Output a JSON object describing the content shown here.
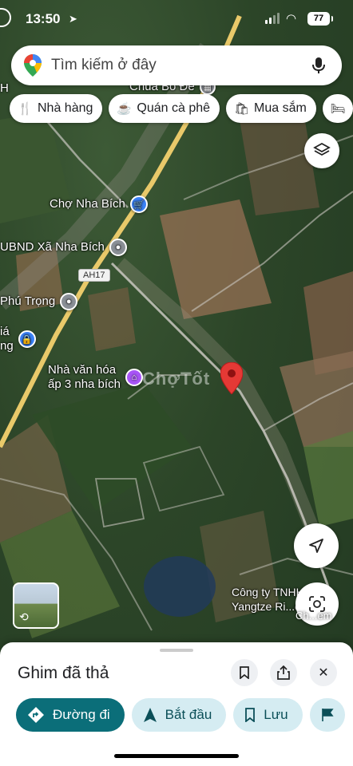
{
  "status_bar": {
    "time": "13:50",
    "battery": "77"
  },
  "search": {
    "placeholder": "Tìm kiếm ở đây"
  },
  "chips": [
    {
      "label": "Nhà hàng",
      "icon": "fork-knife-icon"
    },
    {
      "label": "Quán cà phê",
      "icon": "coffee-cup-icon"
    },
    {
      "label": "Mua sắm",
      "icon": "shopping-bag-icon"
    },
    {
      "label": "",
      "icon": "hotel-bed-icon"
    }
  ],
  "map": {
    "places": [
      {
        "label": "Chùa Bồ Đề",
        "kind": "temple"
      },
      {
        "label": "H",
        "kind": "fragment"
      },
      {
        "label": "Chợ Nha Bích",
        "kind": "market",
        "color": "#3b82f6"
      },
      {
        "label": "UBND Xã Nha Bích",
        "kind": "government",
        "color": "#8a8f96"
      },
      {
        "label": "Phú Trọng",
        "kind": "government",
        "color": "#8a8f96"
      },
      {
        "label": "iá\nng",
        "kind": "landmark",
        "color": "#3b82f6"
      },
      {
        "label": "Nhà văn hóa\nấp 3 nha bích",
        "kind": "culture",
        "color": "#a855f7"
      }
    ],
    "road_badge": "AH17",
    "watermark": "ChợTốt",
    "business": {
      "line1": "Công ty TNHH",
      "line2": "Yangtze Ri...od"
    },
    "lens_label": "Ch...em"
  },
  "sheet": {
    "title": "Ghim đã thả",
    "actions": [
      {
        "label": "Đường đi",
        "style": "primary"
      },
      {
        "label": "Bắt đầu",
        "style": "secondary"
      },
      {
        "label": "Lưu",
        "style": "secondary"
      },
      {
        "label": "",
        "style": "secondary"
      }
    ]
  },
  "colors": {
    "accent": "#0b6e79",
    "pin": "#e53935",
    "road": "#e9c96a"
  }
}
